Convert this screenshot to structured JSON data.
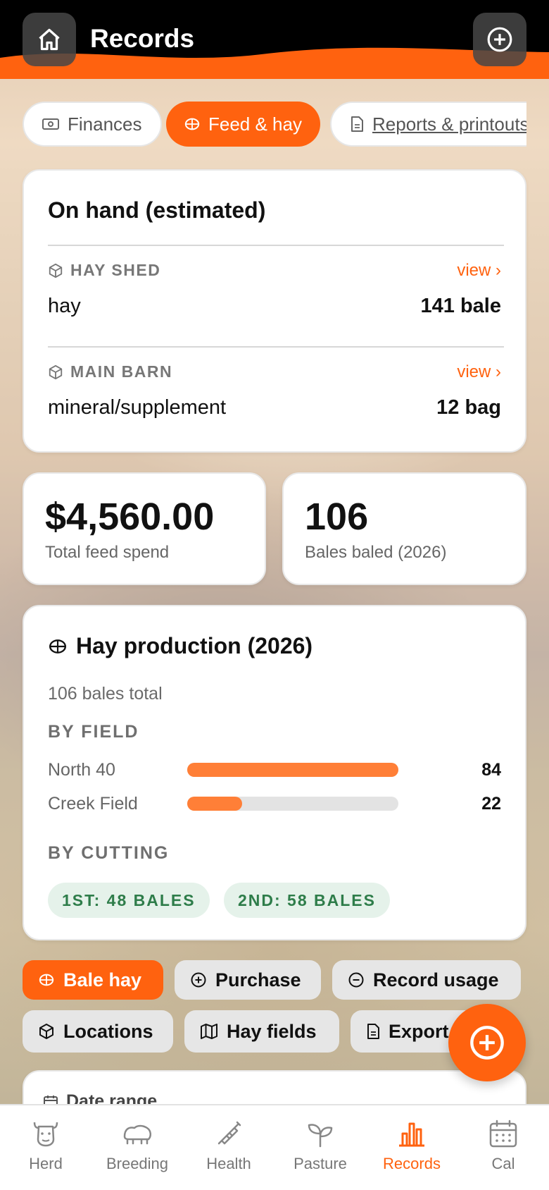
{
  "header": {
    "title": "Records"
  },
  "segments": [
    {
      "label": "Finances",
      "icon": "cash-icon",
      "active": false
    },
    {
      "label": "Feed & hay",
      "icon": "hay-bale-icon",
      "active": true
    },
    {
      "label": "Reports & printouts",
      "icon": "document-icon",
      "active": false
    }
  ],
  "on_hand": {
    "title": "On hand (estimated)",
    "locations": [
      {
        "label": "HAY SHED",
        "view": "view ›",
        "item": "hay",
        "qty": "141 bale"
      },
      {
        "label": "MAIN BARN",
        "view": "view ›",
        "item": "mineral/supplement",
        "qty": "12 bag"
      }
    ]
  },
  "stats": [
    {
      "value": "$4,560.00",
      "label": "Total feed spend"
    },
    {
      "value": "106",
      "label": "Bales baled (2026)"
    }
  ],
  "hay_production": {
    "title": "Hay production (2026)",
    "total": "106 bales total",
    "by_field_label": "BY FIELD",
    "fields": [
      {
        "name": "North 40",
        "value": "84",
        "fraction": 1.0
      },
      {
        "name": "Creek Field",
        "value": "22",
        "fraction": 0.26
      }
    ],
    "by_cutting_label": "BY CUTTING",
    "cuttings": [
      "1ST: 48 BALES",
      "2ND: 58 BALES"
    ]
  },
  "actions": {
    "bale_hay": "Bale hay",
    "purchase": "Purchase",
    "record_usage": "Record usage",
    "locations": "Locations",
    "hay_fields": "Hay fields",
    "export": "Export"
  },
  "date_range": {
    "label": "Date range"
  },
  "tabs": [
    {
      "label": "Herd",
      "icon": "cow-icon",
      "active": false
    },
    {
      "label": "Breeding",
      "icon": "breeding-icon",
      "active": false
    },
    {
      "label": "Health",
      "icon": "syringe-icon",
      "active": false
    },
    {
      "label": "Pasture",
      "icon": "sprout-icon",
      "active": false
    },
    {
      "label": "Records",
      "icon": "bar-chart-icon",
      "active": true
    },
    {
      "label": "Cal",
      "icon": "calendar-icon",
      "active": false
    }
  ],
  "colors": {
    "accent": "#ff620f",
    "bar": "#ff7f37",
    "green_text": "#2e7d4a"
  }
}
